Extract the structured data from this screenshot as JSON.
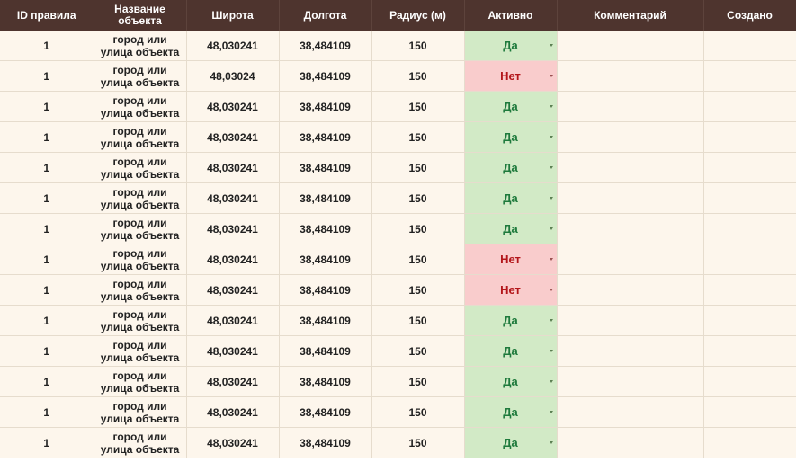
{
  "headers": {
    "id": "ID правила",
    "name": "Название объекта",
    "lat": "Широта",
    "lon": "Долгота",
    "radius": "Радиус (м)",
    "active": "Активно",
    "comment": "Комментарий",
    "created": "Создано"
  },
  "colors": {
    "header_bg": "#4e342e",
    "row_bg": "#fdf6ec",
    "active_yes_bg": "#d2eac6",
    "active_yes_text": "#1e7a3c",
    "active_no_bg": "#f9cccc",
    "active_no_text": "#b3161a"
  },
  "rows": [
    {
      "id": "1",
      "name": "город или улица объекта",
      "lat": "48,030241",
      "lon": "38,484109",
      "radius": "150",
      "active": "Да",
      "comment": "",
      "created": ""
    },
    {
      "id": "1",
      "name": "город или улица объекта",
      "lat": "48,03024",
      "lon": "38,484109",
      "radius": "150",
      "active": "Нет",
      "comment": "",
      "created": ""
    },
    {
      "id": "1",
      "name": "город или улица объекта",
      "lat": "48,030241",
      "lon": "38,484109",
      "radius": "150",
      "active": "Да",
      "comment": "",
      "created": ""
    },
    {
      "id": "1",
      "name": "город или улица объекта",
      "lat": "48,030241",
      "lon": "38,484109",
      "radius": "150",
      "active": "Да",
      "comment": "",
      "created": ""
    },
    {
      "id": "1",
      "name": "город или улица объекта",
      "lat": "48,030241",
      "lon": "38,484109",
      "radius": "150",
      "active": "Да",
      "comment": "",
      "created": ""
    },
    {
      "id": "1",
      "name": "город или улица объекта",
      "lat": "48,030241",
      "lon": "38,484109",
      "radius": "150",
      "active": "Да",
      "comment": "",
      "created": ""
    },
    {
      "id": "1",
      "name": "город или улица объекта",
      "lat": "48,030241",
      "lon": "38,484109",
      "radius": "150",
      "active": "Да",
      "comment": "",
      "created": ""
    },
    {
      "id": "1",
      "name": "город или улица объекта",
      "lat": "48,030241",
      "lon": "38,484109",
      "radius": "150",
      "active": "Нет",
      "comment": "",
      "created": ""
    },
    {
      "id": "1",
      "name": "город или улица объекта",
      "lat": "48,030241",
      "lon": "38,484109",
      "radius": "150",
      "active": "Нет",
      "comment": "",
      "created": ""
    },
    {
      "id": "1",
      "name": "город или улица объекта",
      "lat": "48,030241",
      "lon": "38,484109",
      "radius": "150",
      "active": "Да",
      "comment": "",
      "created": ""
    },
    {
      "id": "1",
      "name": "город или улица объекта",
      "lat": "48,030241",
      "lon": "38,484109",
      "radius": "150",
      "active": "Да",
      "comment": "",
      "created": ""
    },
    {
      "id": "1",
      "name": "город или улица объекта",
      "lat": "48,030241",
      "lon": "38,484109",
      "radius": "150",
      "active": "Да",
      "comment": "",
      "created": ""
    },
    {
      "id": "1",
      "name": "город или улица объекта",
      "lat": "48,030241",
      "lon": "38,484109",
      "radius": "150",
      "active": "Да",
      "comment": "",
      "created": ""
    },
    {
      "id": "1",
      "name": "город или улица объекта",
      "lat": "48,030241",
      "lon": "38,484109",
      "radius": "150",
      "active": "Да",
      "comment": "",
      "created": ""
    }
  ]
}
